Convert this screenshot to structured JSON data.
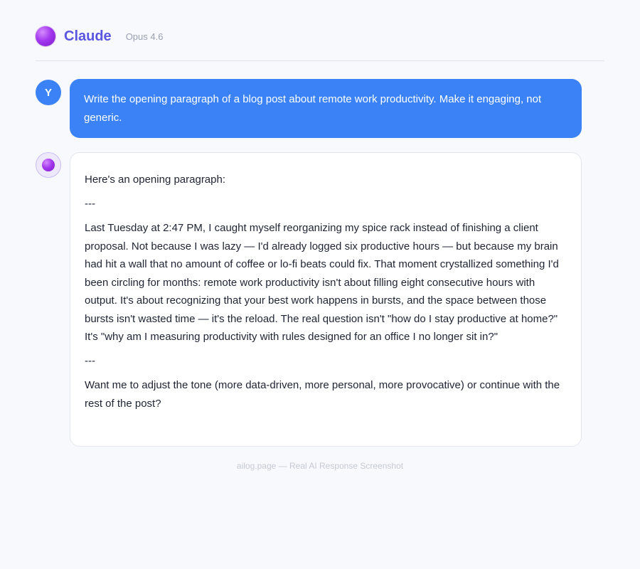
{
  "header": {
    "logo_icon": "purple-orb-icon",
    "title": "Claude",
    "model": "Opus 4.6",
    "accent_color": "#5a55e0"
  },
  "conversation": {
    "user": {
      "avatar_initial": "Y",
      "bubble_color": "#3b82f6",
      "message": "Write the opening paragraph of a blog post about remote work productivity. Make it engaging, not generic."
    },
    "assistant": {
      "avatar_icon": "purple-orb-icon",
      "paragraphs": [
        "Here's an opening paragraph:",
        "---",
        "Last Tuesday at 2:47 PM, I caught myself reorganizing my spice rack instead of finishing a client proposal. Not because I was lazy — I'd already logged six productive hours — but because my brain had hit a wall that no amount of coffee or lo-fi beats could fix. That moment crystallized something I'd been circling for months: remote work productivity isn't about filling eight consecutive hours with output. It's about recognizing that your best work happens in bursts, and the space between those bursts isn't wasted time — it's the reload. The real question isn't \"how do I stay productive at home?\" It's \"why am I measuring productivity with rules designed for an office I no longer sit in?\"",
        "---",
        "Want me to adjust the tone (more data-driven, more personal, more provocative) or continue with the rest of the post?"
      ]
    }
  },
  "footer": {
    "text": "ailog.page — Real AI Response Screenshot"
  }
}
